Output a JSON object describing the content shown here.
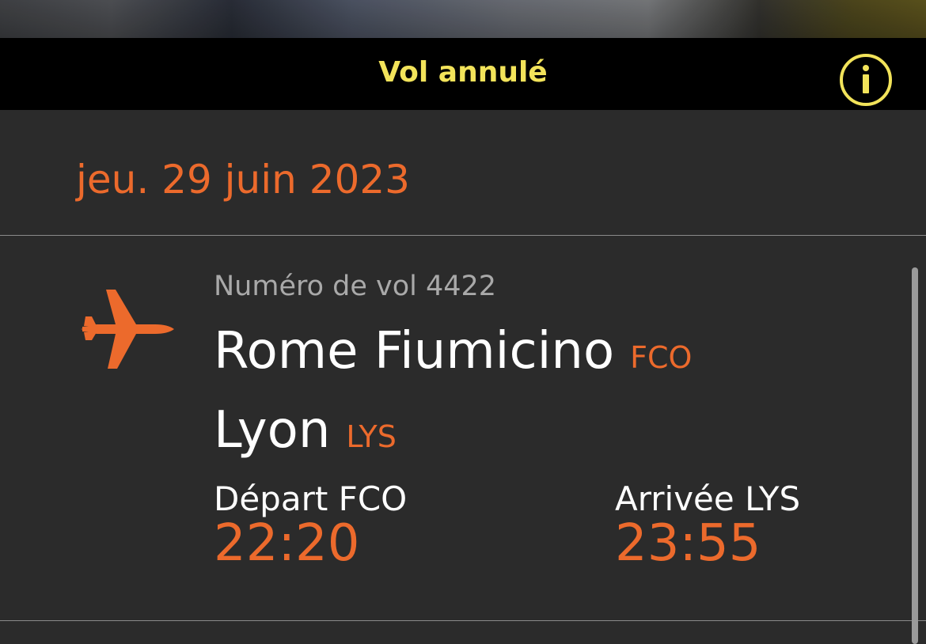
{
  "header": {
    "title": "Vol annulé",
    "info_icon": "info-circle-icon"
  },
  "date": {
    "label": "jeu. 29 juin 2023"
  },
  "flight": {
    "icon": "airplane-icon",
    "number_label": "Numéro de vol 4422",
    "origin": {
      "city": "Rome Fiumicino",
      "code": "FCO"
    },
    "destination": {
      "city": "Lyon",
      "code": "LYS"
    },
    "departure": {
      "label": "Départ FCO",
      "time": "22:20"
    },
    "arrival": {
      "label": "Arrivée LYS",
      "time": "23:55"
    }
  },
  "colors": {
    "accent_yellow": "#f2e35a",
    "accent_orange": "#ec6a2c",
    "background": "#2b2b2b",
    "header_background": "#000000"
  }
}
